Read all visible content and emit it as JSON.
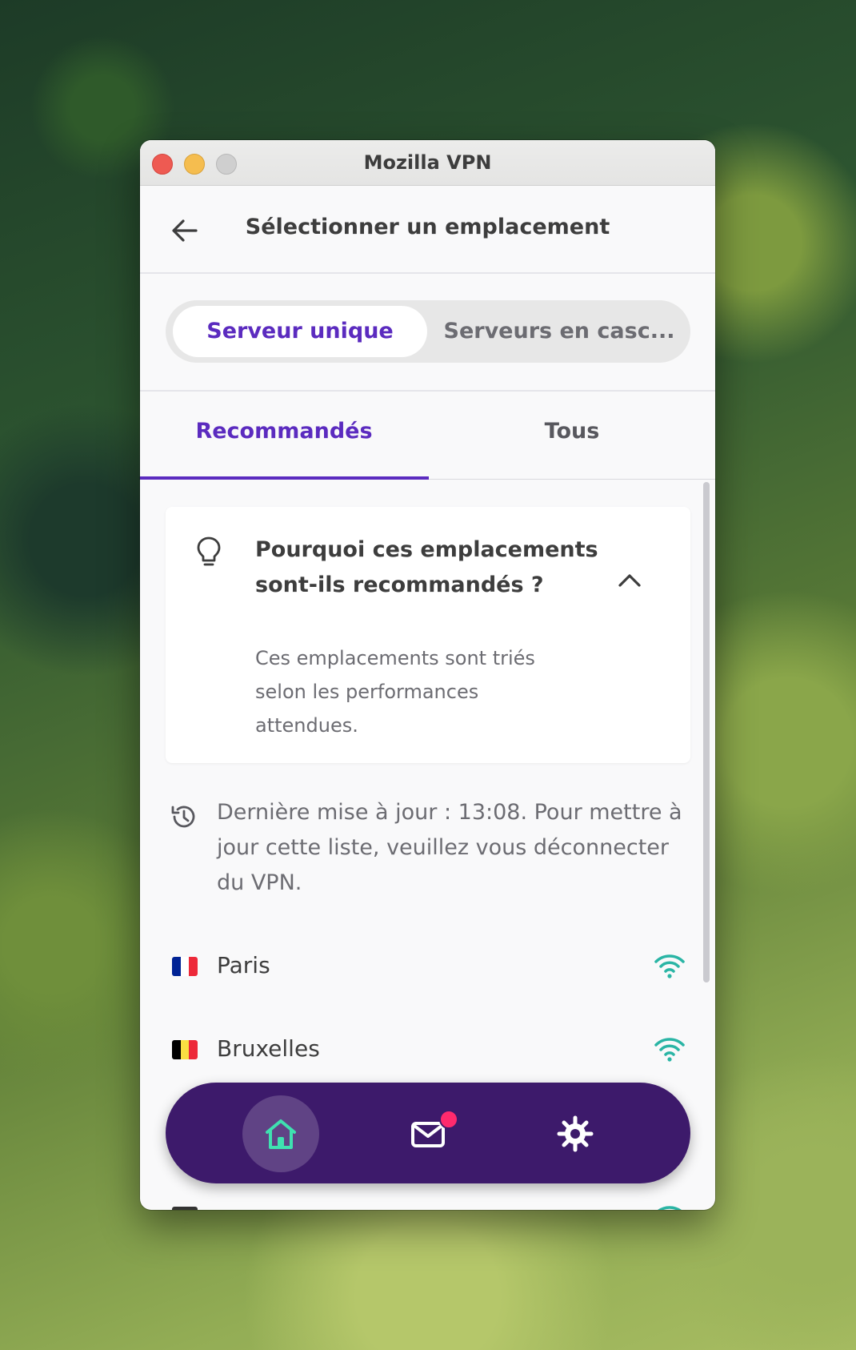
{
  "window": {
    "title": "Mozilla VPN"
  },
  "header": {
    "title": "Sélectionner un emplacement"
  },
  "segmented": {
    "options": [
      "Serveur unique",
      "Serveurs en casc..."
    ],
    "selected": "Serveur unique"
  },
  "tabs": [
    {
      "label": "Recommandés",
      "active": true
    },
    {
      "label": "Tous",
      "active": false
    }
  ],
  "info_card": {
    "icon": "lightbulb-icon",
    "title": "Pourquoi ces emplacements sont-ils recommandés ?",
    "description": "Ces emplacements sont triés selon les performances attendues.",
    "expanded": true
  },
  "update_notice": {
    "icon": "history-icon",
    "text": "Dernière mise à jour : 13:08. Pour mettre à jour cette liste, veuillez vous déconnecter du VPN."
  },
  "servers": [
    {
      "name": "Paris",
      "flag_colors": [
        "#002395",
        "#ffffff",
        "#ed2939"
      ],
      "signal": "good"
    },
    {
      "name": "Bruxelles",
      "flag_colors": [
        "#000000",
        "#fae042",
        "#ed2939"
      ],
      "signal": "good"
    }
  ],
  "navbar": {
    "items": [
      {
        "name": "home",
        "icon": "home-icon",
        "active": true
      },
      {
        "name": "messages",
        "icon": "mail-icon",
        "has_notification": true
      },
      {
        "name": "settings",
        "icon": "gear-icon"
      }
    ]
  },
  "colors": {
    "accent": "#5b2bbf",
    "navbar": "#3d1a6b",
    "signal": "#2ab5a5",
    "notification": "#ff2a6d"
  }
}
